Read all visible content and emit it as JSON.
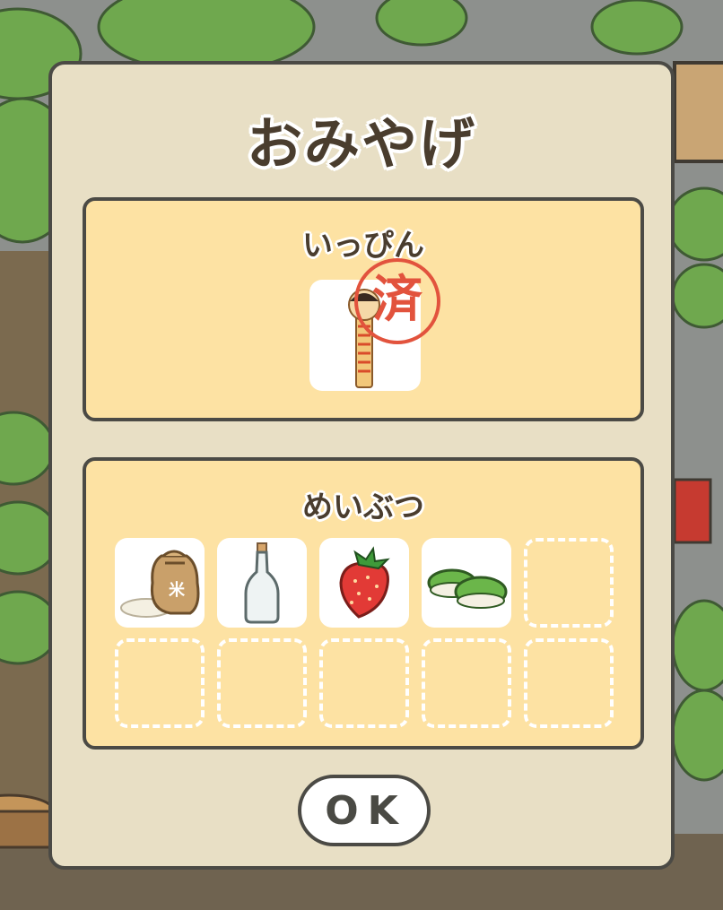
{
  "dialog": {
    "title": "おみやげ",
    "specialty_section": {
      "label": "いっぴん",
      "items": [
        {
          "icon": "kokeshi-doll-icon",
          "collected": true,
          "stamp": "済"
        }
      ]
    },
    "local_goods_section": {
      "label": "めいぶつ",
      "items": [
        {
          "icon": "rice-bag-icon",
          "filled": true
        },
        {
          "icon": "glass-bottle-icon",
          "filled": true
        },
        {
          "icon": "strawberry-icon",
          "filled": true
        },
        {
          "icon": "green-mochi-icon",
          "filled": true
        },
        {
          "filled": false
        },
        {
          "filled": false
        },
        {
          "filled": false
        },
        {
          "filled": false
        },
        {
          "filled": false
        },
        {
          "filled": false
        }
      ]
    },
    "ok_label": "OK"
  },
  "colors": {
    "dialog_bg": "#e8dfc5",
    "panel_bg": "#fde2a3",
    "border": "#4b4a45",
    "stamp": "#e2533d"
  }
}
